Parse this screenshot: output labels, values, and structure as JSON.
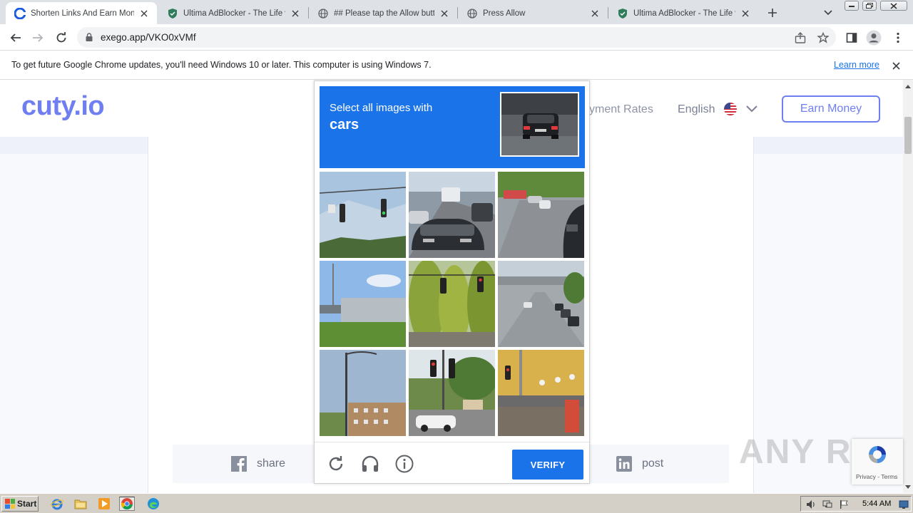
{
  "browser": {
    "tabs": [
      {
        "title": "Shorten Links And Earn Money",
        "favicon": "cuty-icon",
        "active": true
      },
      {
        "title": "Ultima AdBlocker - The Life with",
        "favicon": "shield-icon",
        "active": false
      },
      {
        "title": "## Please tap the Allow button",
        "favicon": "globe-icon",
        "active": false
      },
      {
        "title": "Press Allow",
        "favicon": "globe-icon",
        "active": false
      },
      {
        "title": "Ultima AdBlocker - The Life with",
        "favicon": "shield-icon",
        "active": false
      }
    ],
    "url": "exego.app/VKO0xVMf",
    "infobar": {
      "message": "To get future Google Chrome updates, you'll need Windows 10 or later. This computer is using Windows 7.",
      "link": "Learn more"
    }
  },
  "site": {
    "logo": "cuty.io",
    "nav_rates": "yment Rates",
    "nav_language": "English",
    "earn_button": "Earn Money",
    "share_label": "share",
    "post_label": "post",
    "accent": "#6f7ef0"
  },
  "captcha": {
    "instruction": "Select all images with",
    "target": "cars",
    "verify_label": "VERIFY",
    "tile_scenes": [
      "traffic-lights-sky",
      "highway-traffic-cars",
      "road-parked-cars",
      "overpass-field",
      "traffic-lights-trees",
      "street-parked-cars",
      "streetlight-building",
      "traffic-light-white-car",
      "storefront-street"
    ],
    "accent": "#1a73e8"
  },
  "recaptcha_badge": {
    "links": "Privacy - Terms"
  },
  "watermark": "ANY RUN",
  "taskbar": {
    "start_label": "Start",
    "clock": "5:44 AM"
  }
}
